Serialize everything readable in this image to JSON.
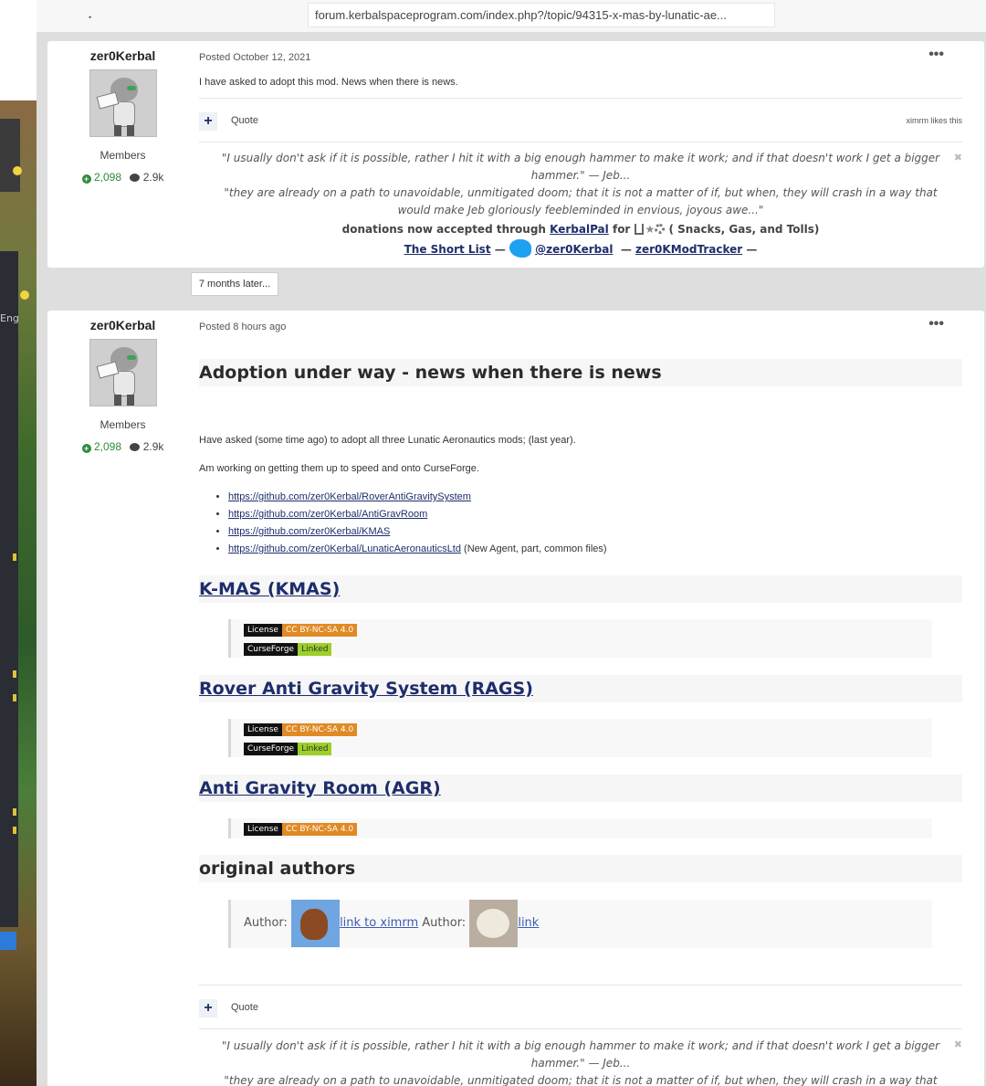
{
  "browser": {
    "url": "forum.kerbalspaceprogram.com/index.php?/topic/94315-x-mas-by-lunatic-ae...",
    "side_label": "Eng"
  },
  "post1": {
    "author": "zer0Kerbal",
    "group": "Members",
    "rep": "2,098",
    "posts": "2.9k",
    "meta": "Posted October 12, 2021",
    "body": "I have asked to adopt this mod. News when there is news.",
    "quote_label": "Quote",
    "likes": "ximrm likes this"
  },
  "signature": {
    "q1": "\"I usually don't ask if it is possible, rather I hit it with a big enough hammer to make it work; and if that doesn't work I get a bigger hammer.\"  — Jeb...",
    "q2": "\"they are already on a path to unavoidable, unmitigated doom; that it is not a matter of if, but when, they will crash in a way that would make Jeb gloriously feebleminded in envious, joyous awe...\"",
    "donate_pre": "donations now accepted through",
    "kerbalpal": "KerbalPal",
    "donate_for": "for",
    "donate_post": "( Snacks, Gas, and Tolls)",
    "shortlist": "The Short List",
    "twitter": "@zer0Kerbal",
    "tracker": "zer0KModTracker",
    "dash": "—"
  },
  "later": "7 months later...",
  "post2": {
    "author": "zer0Kerbal",
    "group": "Members",
    "rep": "2,098",
    "posts": "2.9k",
    "meta": "Posted 8 hours ago",
    "title": "Adoption under way - news when there is news",
    "p1": "Have asked (some time ago) to adopt all three Lunatic Aeronautics mods; (last year).",
    "p2": "Am working on getting them up to speed and onto CurseForge.",
    "links": [
      {
        "url": "https://github.com/zer0Kerbal/RoverAntiGravitySystem",
        "note": ""
      },
      {
        "url": "https://github.com/zer0Kerbal/AntiGravRoom",
        "note": ""
      },
      {
        "url": "https://github.com/zer0Kerbal/KMAS",
        "note": ""
      },
      {
        "url": "https://github.com/zer0Kerbal/LunaticAeronauticsLtd",
        "note": " (New Agent, part, common files)"
      }
    ],
    "sections": [
      {
        "title": "K-MAS (KMAS)"
      },
      {
        "title": "Rover Anti Gravity System (RAGS)"
      },
      {
        "title": "Anti Gravity Room (AGR)"
      }
    ],
    "badges": {
      "license_l": "License",
      "license_r": "CC BY-NC-SA 4.0",
      "cf_l": "CurseForge",
      "cf_r": "Linked"
    },
    "orig_title": "original authors",
    "author_label": "Author:",
    "link1": "link to ximrm",
    "link2": "link",
    "quote_label": "Quote"
  },
  "icons": {
    "plus": "+",
    "more": "•••",
    "close": "✖"
  }
}
